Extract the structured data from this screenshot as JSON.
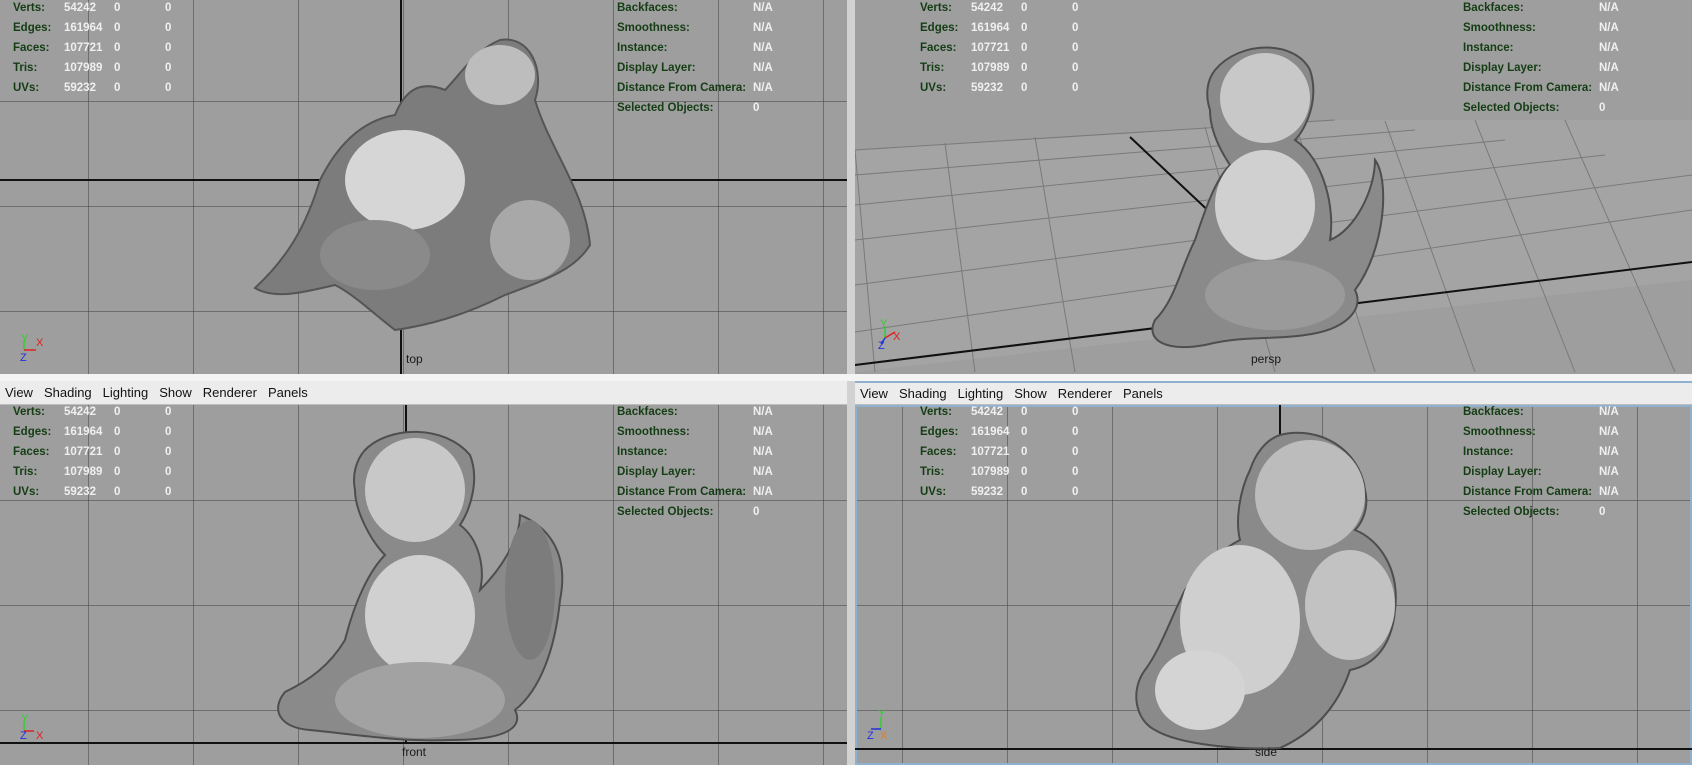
{
  "stats_left": [
    {
      "label": "Verts:",
      "v1": "54242",
      "v2": "0",
      "v3": "0"
    },
    {
      "label": "Edges:",
      "v1": "161964",
      "v2": "0",
      "v3": "0"
    },
    {
      "label": "Faces:",
      "v1": "107721",
      "v2": "0",
      "v3": "0"
    },
    {
      "label": "Tris:",
      "v1": "107989",
      "v2": "0",
      "v3": "0"
    },
    {
      "label": "UVs:",
      "v1": "59232",
      "v2": "0",
      "v3": "0"
    }
  ],
  "stats_right": [
    {
      "label": "Backfaces:",
      "value": "N/A"
    },
    {
      "label": "Smoothness:",
      "value": "N/A"
    },
    {
      "label": "Instance:",
      "value": "N/A"
    },
    {
      "label": "Display Layer:",
      "value": "N/A"
    },
    {
      "label": "Distance From Camera:",
      "value": "N/A"
    },
    {
      "label": "Selected Objects:",
      "value": "0"
    }
  ],
  "menu": [
    "View",
    "Shading",
    "Lighting",
    "Show",
    "Renderer",
    "Panels"
  ],
  "viewports": {
    "top": {
      "camera": "top",
      "axis_a": "Y",
      "axis_b": "X",
      "axis_c": "Z"
    },
    "persp": {
      "camera": "persp",
      "axis_a": "Y",
      "axis_b": "X",
      "axis_c": "Z"
    },
    "front": {
      "camera": "front",
      "axis_a": "Y",
      "axis_b": "X",
      "axis_c": "Z"
    },
    "side": {
      "camera": "side",
      "axis_a": "Y",
      "axis_b": "X",
      "axis_c": "Z"
    }
  },
  "colors": {
    "axis_x": "#e02020",
    "axis_y": "#30d030",
    "axis_z": "#2030e0",
    "hud_label": "#143d14",
    "hud_value": "#f0f0f0"
  }
}
